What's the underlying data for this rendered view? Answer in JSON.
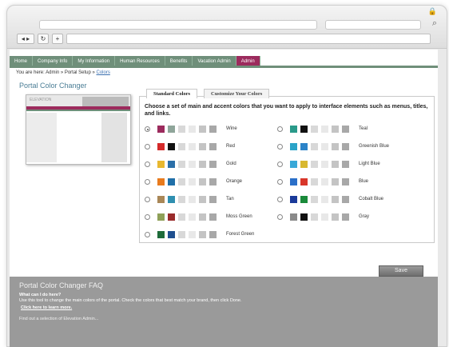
{
  "browser": {
    "lock_glyph": "🔒",
    "search_glyph": "⌕",
    "back_label": "◂ ▸",
    "reload_label": "↻",
    "new_tab_label": "+"
  },
  "tabs": [
    {
      "label": "Home",
      "active": false
    },
    {
      "label": "Company Info",
      "active": false
    },
    {
      "label": "My Information",
      "active": false
    },
    {
      "label": "Human Resources",
      "active": false
    },
    {
      "label": "Benefits",
      "active": false
    },
    {
      "label": "Vacation Admin",
      "active": false
    },
    {
      "label": "Admin",
      "active": true
    }
  ],
  "breadcrumb": {
    "prefix": "You are here: Admin » Portal Setup » ",
    "current": "Colors"
  },
  "page_title": "Portal Color Changer",
  "preview": {
    "logo_text": "ELEVATION"
  },
  "panel": {
    "tabs": {
      "standard": "Standard Colors",
      "customize": "Customize Your Colors"
    },
    "instructions": "Choose a set of main and accent colors that you want to apply to interface elements such as menus, titles, and links."
  },
  "schemes": [
    {
      "name": "Wine",
      "selected": true,
      "main": "#9c2b5d",
      "accent": "#8fa59a"
    },
    {
      "name": "Red",
      "selected": false,
      "main": "#d42a2a",
      "accent": "#111111"
    },
    {
      "name": "Gold",
      "selected": false,
      "main": "#e8b830",
      "accent": "#2b6fa8"
    },
    {
      "name": "Orange",
      "selected": false,
      "main": "#e87b1e",
      "accent": "#1f6fa8"
    },
    {
      "name": "Tan",
      "selected": false,
      "main": "#a98757",
      "accent": "#2f8fb0"
    },
    {
      "name": "Moss Green",
      "selected": false,
      "main": "#8fa058",
      "accent": "#9a2b2b"
    },
    {
      "name": "Forest Green",
      "selected": false,
      "main": "#1e6b3a",
      "accent": "#1f4f8f"
    },
    {
      "name": "Teal",
      "selected": false,
      "main": "#2a9a8a",
      "accent": "#111111"
    },
    {
      "name": "Greenish Blue",
      "selected": false,
      "main": "#2ba3c8",
      "accent": "#2b83c8"
    },
    {
      "name": "Light Blue",
      "selected": false,
      "main": "#38a8d8",
      "accent": "#d8b830"
    },
    {
      "name": "Blue",
      "selected": false,
      "main": "#2a6fc8",
      "accent": "#d8362a"
    },
    {
      "name": "Cobalt Blue",
      "selected": false,
      "main": "#1a3a9a",
      "accent": "#1a8a3a"
    },
    {
      "name": "Gray",
      "selected": false,
      "main": "#8a8a8a",
      "accent": "#111111"
    }
  ],
  "neutral_swatches": [
    "#d8d8d8",
    "#e8e8e8",
    "#c4c4c4",
    "#a8a8a8"
  ],
  "save_label": "Save",
  "faq": {
    "title": "Portal Color Changer FAQ",
    "question": "What can I do here?",
    "answer": "Use this tool to change the main colors of the portal. Check the colors that best match your brand, then click Done.",
    "link": "Click here to learn more.",
    "note": "Find out a selection of Elevation Admin..."
  }
}
